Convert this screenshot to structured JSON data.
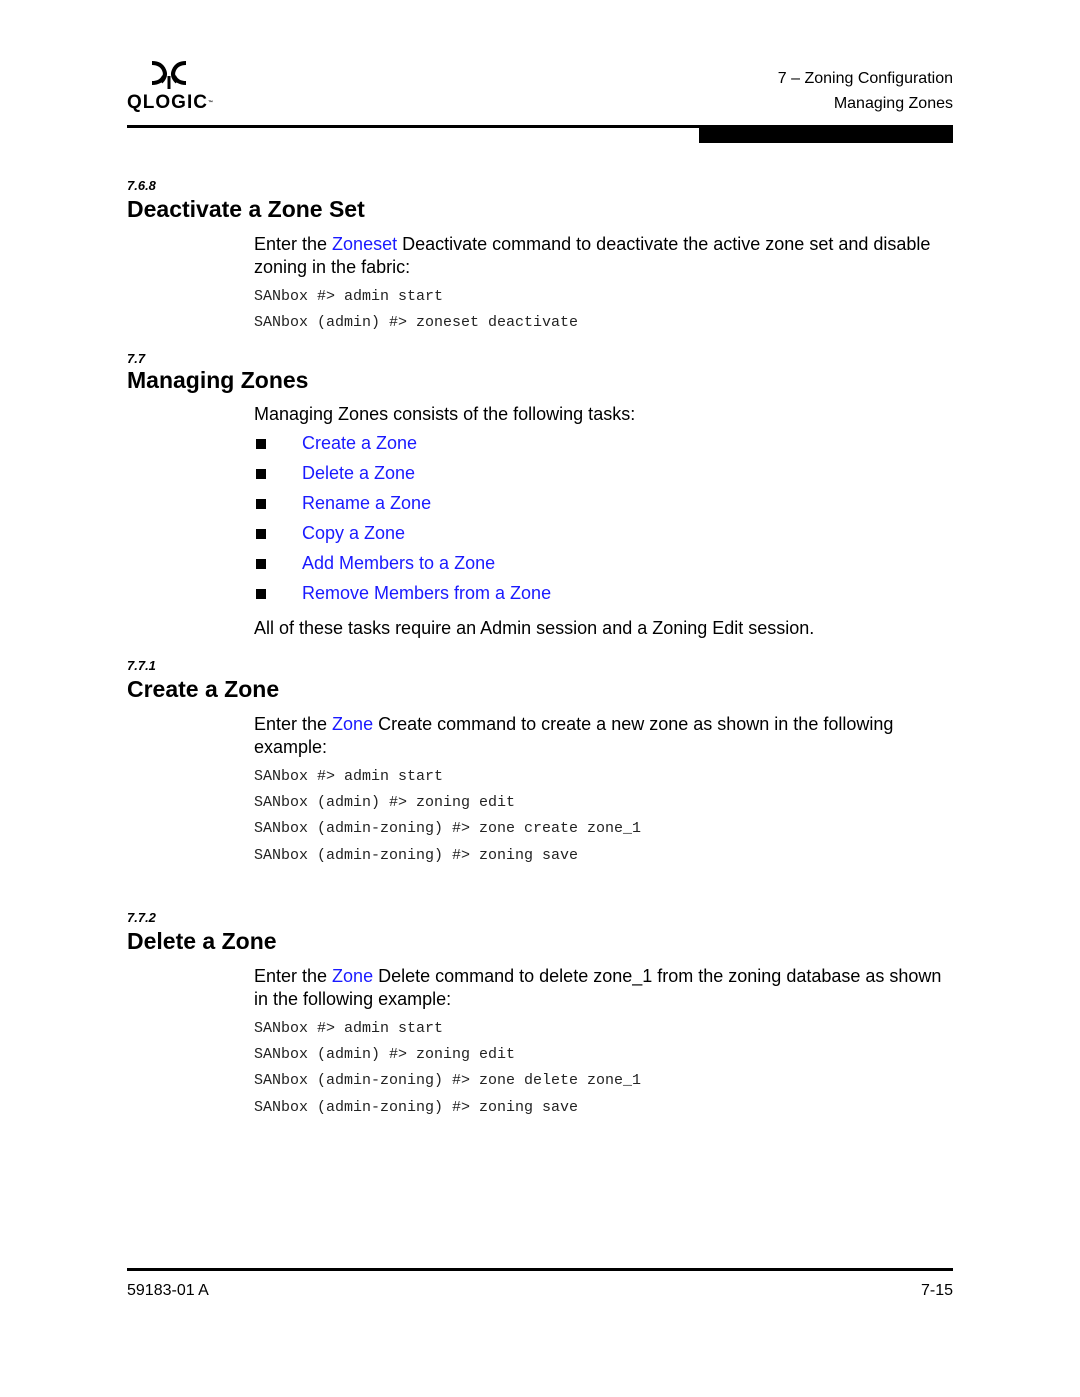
{
  "header": {
    "logo_text": "QLOGIC",
    "logo_tm": "™",
    "chapter": "7 – Zoning Configuration",
    "section": "Managing Zones"
  },
  "sections": {
    "s768": {
      "number": "7.6.8",
      "title": "Deactivate a Zone Set",
      "para_prefix": "Enter the ",
      "para_link": "Zoneset",
      "para_suffix": " Deactivate command to deactivate the active zone set and disable zoning in the fabric:",
      "code": [
        "SANbox #> admin start",
        "SANbox (admin) #> zoneset deactivate"
      ]
    },
    "s77": {
      "number": "7.7",
      "title": "Managing Zones",
      "intro": "Managing Zones consists of the following tasks:",
      "tasks": [
        "Create a Zone",
        "Delete a Zone",
        "Rename a Zone",
        "Copy a Zone",
        "Add Members to a Zone",
        "Remove Members from a Zone"
      ],
      "outro": "All of these tasks require an Admin session and a Zoning Edit session."
    },
    "s771": {
      "number": "7.7.1",
      "title": "Create a Zone",
      "para_prefix": "Enter the ",
      "para_link": "Zone",
      "para_suffix": " Create command to create a new zone as shown in the following example:",
      "code": [
        "SANbox #> admin start",
        "SANbox (admin) #> zoning edit",
        "SANbox (admin-zoning) #> zone create zone_1",
        "SANbox (admin-zoning) #> zoning save"
      ]
    },
    "s772": {
      "number": "7.7.2",
      "title": "Delete a Zone",
      "para_prefix": "Enter the ",
      "para_link": "Zone",
      "para_suffix": " Delete command to delete zone_1 from the zoning database as shown in the following example:",
      "code": [
        "SANbox #> admin start",
        "SANbox (admin) #> zoning edit",
        "SANbox (admin-zoning) #> zone delete zone_1",
        "SANbox (admin-zoning) #> zoning save"
      ]
    }
  },
  "footer": {
    "doc_number": "59183-01 A",
    "page_number": "7-15"
  }
}
